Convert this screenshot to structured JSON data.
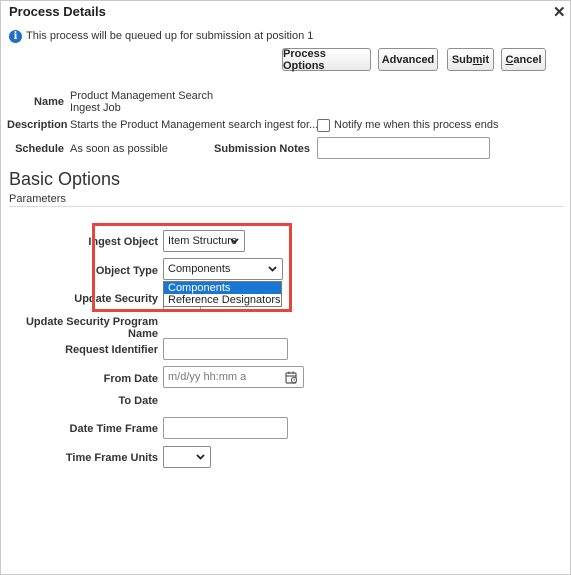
{
  "dialog": {
    "title": "Process Details"
  },
  "info": {
    "message": "This process will be queued up for submission at position 1"
  },
  "buttons": {
    "process_options": "Process Options",
    "advanced": "Advanced",
    "submit_pre": "Sub",
    "submit_ul": "m",
    "submit_post": "it",
    "cancel_ul": "C",
    "cancel_post": "ancel"
  },
  "details": {
    "name_label": "Name",
    "name_line1": "Product Management Search",
    "name_line2": "Ingest Job",
    "description_label": "Description",
    "description_value": "Starts the Product Management search ingest for...",
    "notify_label": "Notify me when this process ends",
    "schedule_label": "Schedule",
    "schedule_value": "As soon as possible",
    "submission_notes_label": "Submission Notes"
  },
  "basic_options": {
    "title": "Basic Options",
    "parameters_label": "Parameters"
  },
  "params": {
    "ingest_object_label": "Ingest Object",
    "ingest_object_value": "Item Structure",
    "object_type_label": "Object Type",
    "object_type_value": "Components",
    "object_type_options": [
      "Components",
      "Reference Designators"
    ],
    "update_security_label": "Update Security",
    "update_security_program_label": "Update Security Program Name",
    "request_identifier_label": "Request Identifier",
    "from_date_label": "From Date",
    "from_date_placeholder": "m/d/yy hh:mm a",
    "to_date_label": "To Date",
    "date_time_frame_label": "Date Time Frame",
    "time_frame_units_label": "Time Frame Units"
  },
  "colors": {
    "accent": "#1976d2",
    "highlight": "#e5463c",
    "info": "#1f6fc5"
  }
}
